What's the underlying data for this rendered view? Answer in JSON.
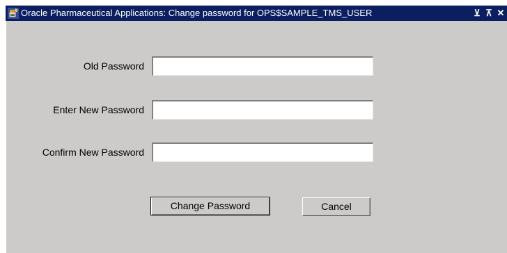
{
  "window": {
    "title": "Oracle Pharmaceutical Applications: Change password for OPS$SAMPLE_TMS_USER",
    "controls": {
      "minimize_glyph": "⊻",
      "maximize_glyph": "⊼",
      "close_glyph": "✕"
    },
    "icons": [
      "app-icon",
      "minimize-icon",
      "maximize-icon",
      "close-icon"
    ]
  },
  "form": {
    "old_password": {
      "label": "Old Password",
      "value": ""
    },
    "new_password": {
      "label": "Enter New Password",
      "value": ""
    },
    "confirm_password": {
      "label": "Confirm New Password",
      "value": ""
    }
  },
  "buttons": {
    "change_password": "Change Password",
    "cancel": "Cancel"
  },
  "colors": {
    "titlebar": "#0a1e60",
    "dialog_background": "#cdcbc9",
    "field_background": "#ffffff"
  }
}
